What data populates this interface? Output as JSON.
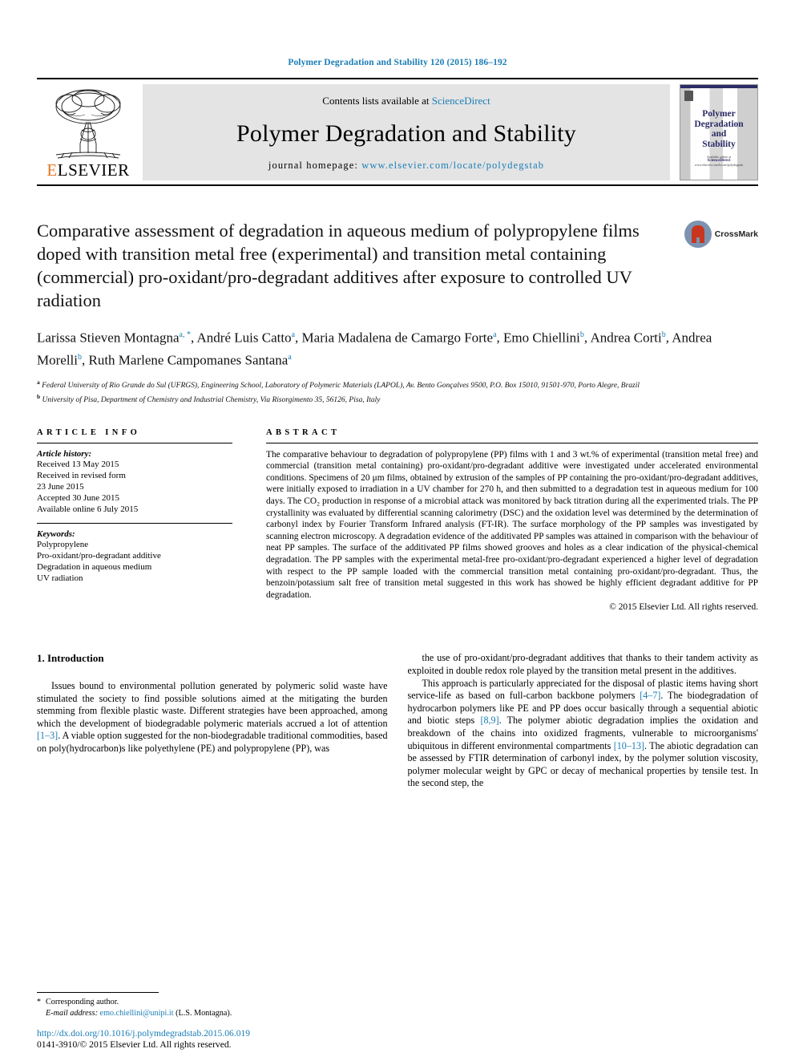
{
  "running_head": "Polymer Degradation and Stability 120 (2015) 186–192",
  "masthead": {
    "publisher_name": "ELSEVIER",
    "publisher_initial": "E",
    "publisher_rest": "LSEVIER",
    "contents_prefix": "Contents lists available at ",
    "contents_link": "ScienceDirect",
    "journal_title": "Polymer Degradation and Stability",
    "homepage_prefix": "journal homepage: ",
    "homepage_url": "www.elsevier.com/locate/polydegstab",
    "cover": {
      "title_lines": [
        "Polymer",
        "Degradation",
        "and",
        "Stability"
      ],
      "foot_small": "Available online at",
      "foot_brand": "ScienceDirect",
      "foot_sub": "www.elsevier.com/locate/polydegstab"
    }
  },
  "article": {
    "title": "Comparative assessment of degradation in aqueous medium of polypropylene films doped with transition metal free (experimental) and transition metal containing (commercial) pro-oxidant/pro-degradant additives after exposure to controlled UV radiation",
    "crossmark_label": "CrossMark",
    "authors": [
      {
        "name": "Larissa Stieven Montagna",
        "marks": "a, *"
      },
      {
        "name": "André Luis Catto",
        "marks": "a"
      },
      {
        "name": "Maria Madalena de Camargo Forte",
        "marks": "a"
      },
      {
        "name": "Emo Chiellini",
        "marks": "b"
      },
      {
        "name": "Andrea Corti",
        "marks": "b"
      },
      {
        "name": "Andrea Morelli",
        "marks": "b"
      },
      {
        "name": "Ruth Marlene Campomanes Santana",
        "marks": "a"
      }
    ],
    "affiliations": [
      {
        "mark": "a",
        "text": "Federal University of Rio Grande do Sul (UFRGS), Engineering School, Laboratory of Polymeric Materials (LAPOL), Av. Bento Gonçalves 9500, P.O. Box 15010, 91501-970, Porto Alegre, Brazil"
      },
      {
        "mark": "b",
        "text": "University of Pisa, Department of Chemistry and Industrial Chemistry, Via Risorgimento 35, 56126, Pisa, Italy"
      }
    ]
  },
  "article_info": {
    "heading": "ARTICLE INFO",
    "history_label": "Article history:",
    "history": [
      "Received 13 May 2015",
      "Received in revised form",
      "23 June 2015",
      "Accepted 30 June 2015",
      "Available online 6 July 2015"
    ],
    "keywords_label": "Keywords:",
    "keywords": [
      "Polypropylene",
      "Pro-oxidant/pro-degradant additive",
      "Degradation in aqueous medium",
      "UV radiation"
    ]
  },
  "abstract": {
    "heading": "ABSTRACT",
    "text": "The comparative behaviour to degradation of polypropylene (PP) films with 1 and 3 wt.% of experimental (transition metal free) and commercial (transition metal containing) pro-oxidant/pro-degradant additive were investigated under accelerated environmental conditions. Specimens of 20 μm films, obtained by extrusion of the samples of PP containing the pro-oxidant/pro-degradant additives, were initially exposed to irradiation in a UV chamber for 270 h, and then submitted to a degradation test in aqueous medium for 100 days. The CO₂ production in response of a microbial attack was monitored by back titration during all the experimented trials. The PP crystallinity was evaluated by differential scanning calorimetry (DSC) and the oxidation level was determined by the determination of carbonyl index by Fourier Transform Infrared analysis (FT-IR). The surface morphology of the PP samples was investigated by scanning electron microscopy. A degradation evidence of the additivated PP samples was attained in comparison with the behaviour of neat PP samples. The surface of the additivated PP films showed grooves and holes as a clear indication of the physical-chemical degradation. The PP samples with the experimental metal-free pro-oxidant/pro-degradant experienced a higher level of degradation with respect to the PP sample loaded with the commercial transition metal containing pro-oxidant/pro-degradant. Thus, the benzoin/potassium salt free of transition metal suggested in this work has showed be highly efficient degradant additive for PP degradation.",
    "copyright": "© 2015 Elsevier Ltd. All rights reserved."
  },
  "body": {
    "section_title": "1. Introduction",
    "left_paragraphs": [
      "Issues bound to environmental pollution generated by polymeric solid waste have stimulated the society to find possible solutions aimed at the mitigating the burden stemming from flexible plastic waste. Different strategies have been approached, among which the development of biodegradable polymeric materials accrued a lot of attention [1–3]. A viable option suggested for the non-biodegradable traditional commodities, based on poly(hydrocarbon)s like polyethylene (PE) and polypropylene (PP), was"
    ],
    "right_paragraphs": [
      "the use of pro-oxidant/pro-degradant additives that thanks to their tandem activity as exploited in double redox role played by the transition metal present in the additives.",
      "This approach is particularly appreciated for the disposal of plastic items having short service-life as based on full-carbon backbone polymers [4–7]. The biodegradation of hydrocarbon polymers like PE and PP does occur basically through a sequential abiotic and biotic steps [8,9]. The polymer abiotic degradation implies the oxidation and breakdown of the chains into oxidized fragments, vulnerable to microorganisms' ubiquitous in different environmental compartments [10–13]. The abiotic degradation can be assessed by FTIR determination of carbonyl index, by the polymer solution viscosity, polymer molecular weight by GPC or decay of mechanical properties by tensile test. In the second step, the"
    ]
  },
  "footer": {
    "corresponding_marker": "*",
    "corresponding_label": "Corresponding author.",
    "email_label": "E-mail address:",
    "email": "emo.chiellini@unipi.it",
    "email_owner": "(L.S. Montagna).",
    "doi": "http://dx.doi.org/10.1016/j.polymdegradstab.2015.06.019",
    "issn": "0141-3910/© 2015 Elsevier Ltd. All rights reserved."
  },
  "colors": {
    "link": "#1a7db6",
    "elsevier_orange": "#e87722",
    "cover_navy": "#2b2b66",
    "crossmark_red": "#c8361f"
  }
}
